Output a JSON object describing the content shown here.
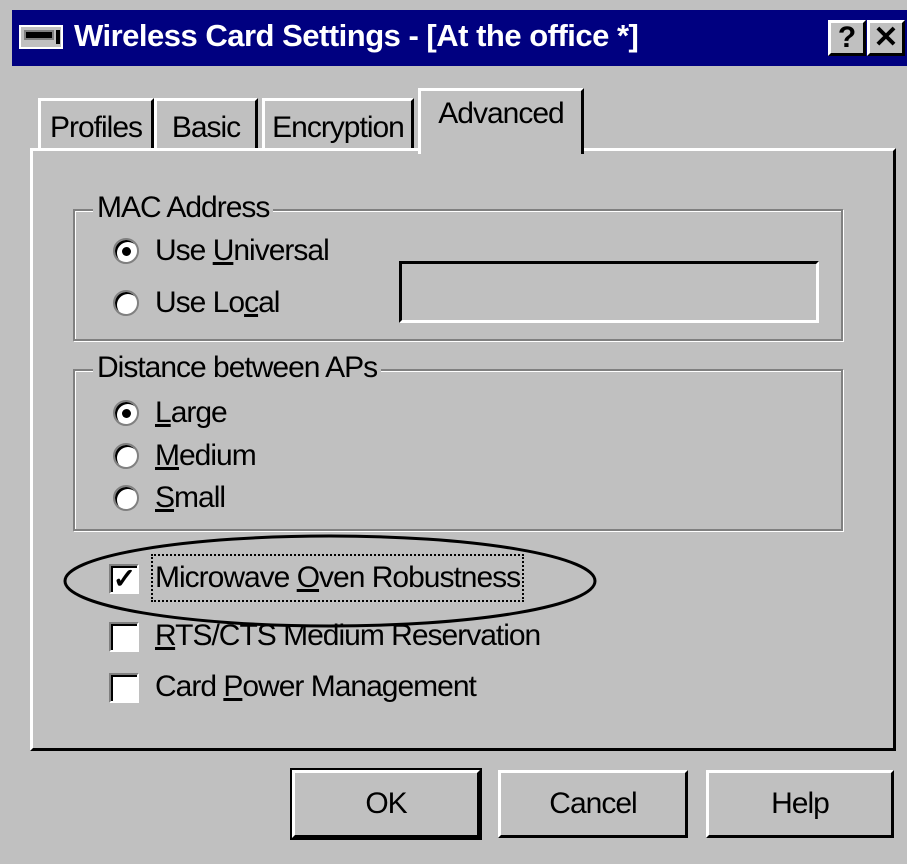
{
  "window": {
    "title": "Wireless Card Settings - [At the office *]",
    "help_button": "?",
    "close_button": "✕"
  },
  "tabs": [
    {
      "label": "Profiles",
      "active": false
    },
    {
      "label": "Basic",
      "active": false
    },
    {
      "label": "Encryption",
      "active": false
    },
    {
      "label": "Advanced",
      "active": true
    }
  ],
  "mac_address": {
    "legend": "MAC Address",
    "options": [
      {
        "pre": "Use ",
        "key": "U",
        "post": "niversal",
        "selected": true
      },
      {
        "pre": "Use Lo",
        "key": "c",
        "post": "al",
        "selected": false
      }
    ],
    "local_value": ""
  },
  "distance": {
    "legend": "Distance between APs",
    "options": [
      {
        "pre": "",
        "key": "L",
        "post": "arge",
        "selected": true
      },
      {
        "pre": "",
        "key": "M",
        "post": "edium",
        "selected": false
      },
      {
        "pre": "",
        "key": "S",
        "post": "mall",
        "selected": false
      }
    ]
  },
  "checkboxes": [
    {
      "pre": "Microwave ",
      "key": "O",
      "post": "ven Robustness",
      "checked": true
    },
    {
      "pre": "",
      "key": "R",
      "post": "TS/CTS Medium Reservation",
      "checked": false
    },
    {
      "pre": "Card ",
      "key": "P",
      "post": "ower Management",
      "checked": false
    }
  ],
  "buttons": {
    "ok": "OK",
    "cancel": "Cancel",
    "help": "Help"
  },
  "colors": {
    "titlebar": "#000080",
    "face": "#c0c0c0"
  }
}
